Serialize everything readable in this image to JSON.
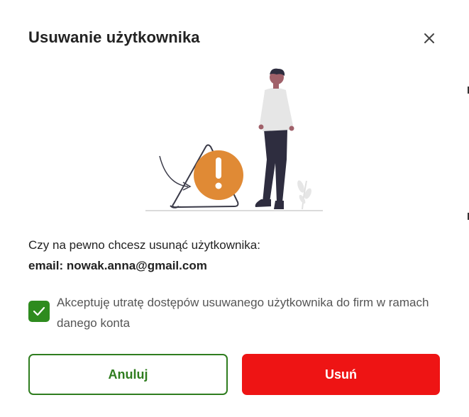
{
  "dialog": {
    "title": "Usuwanie użytkownika",
    "close_icon": "close-icon",
    "question": "Czy na pewno chcesz usunąć użytkownika:",
    "email_line": "email: nowak.anna@gmail.com",
    "consent_checked": true,
    "consent_text": "Akceptuję utratę dostępów usuwanego użytkownika do firm w ramach danego konta",
    "cancel_label": "Anuluj",
    "delete_label": "Usuń"
  },
  "colors": {
    "accent_green": "#2f7d1f",
    "checkbox_green": "#2e8b1e",
    "danger_red": "#ee1414",
    "warning_orange": "#e08a35"
  }
}
